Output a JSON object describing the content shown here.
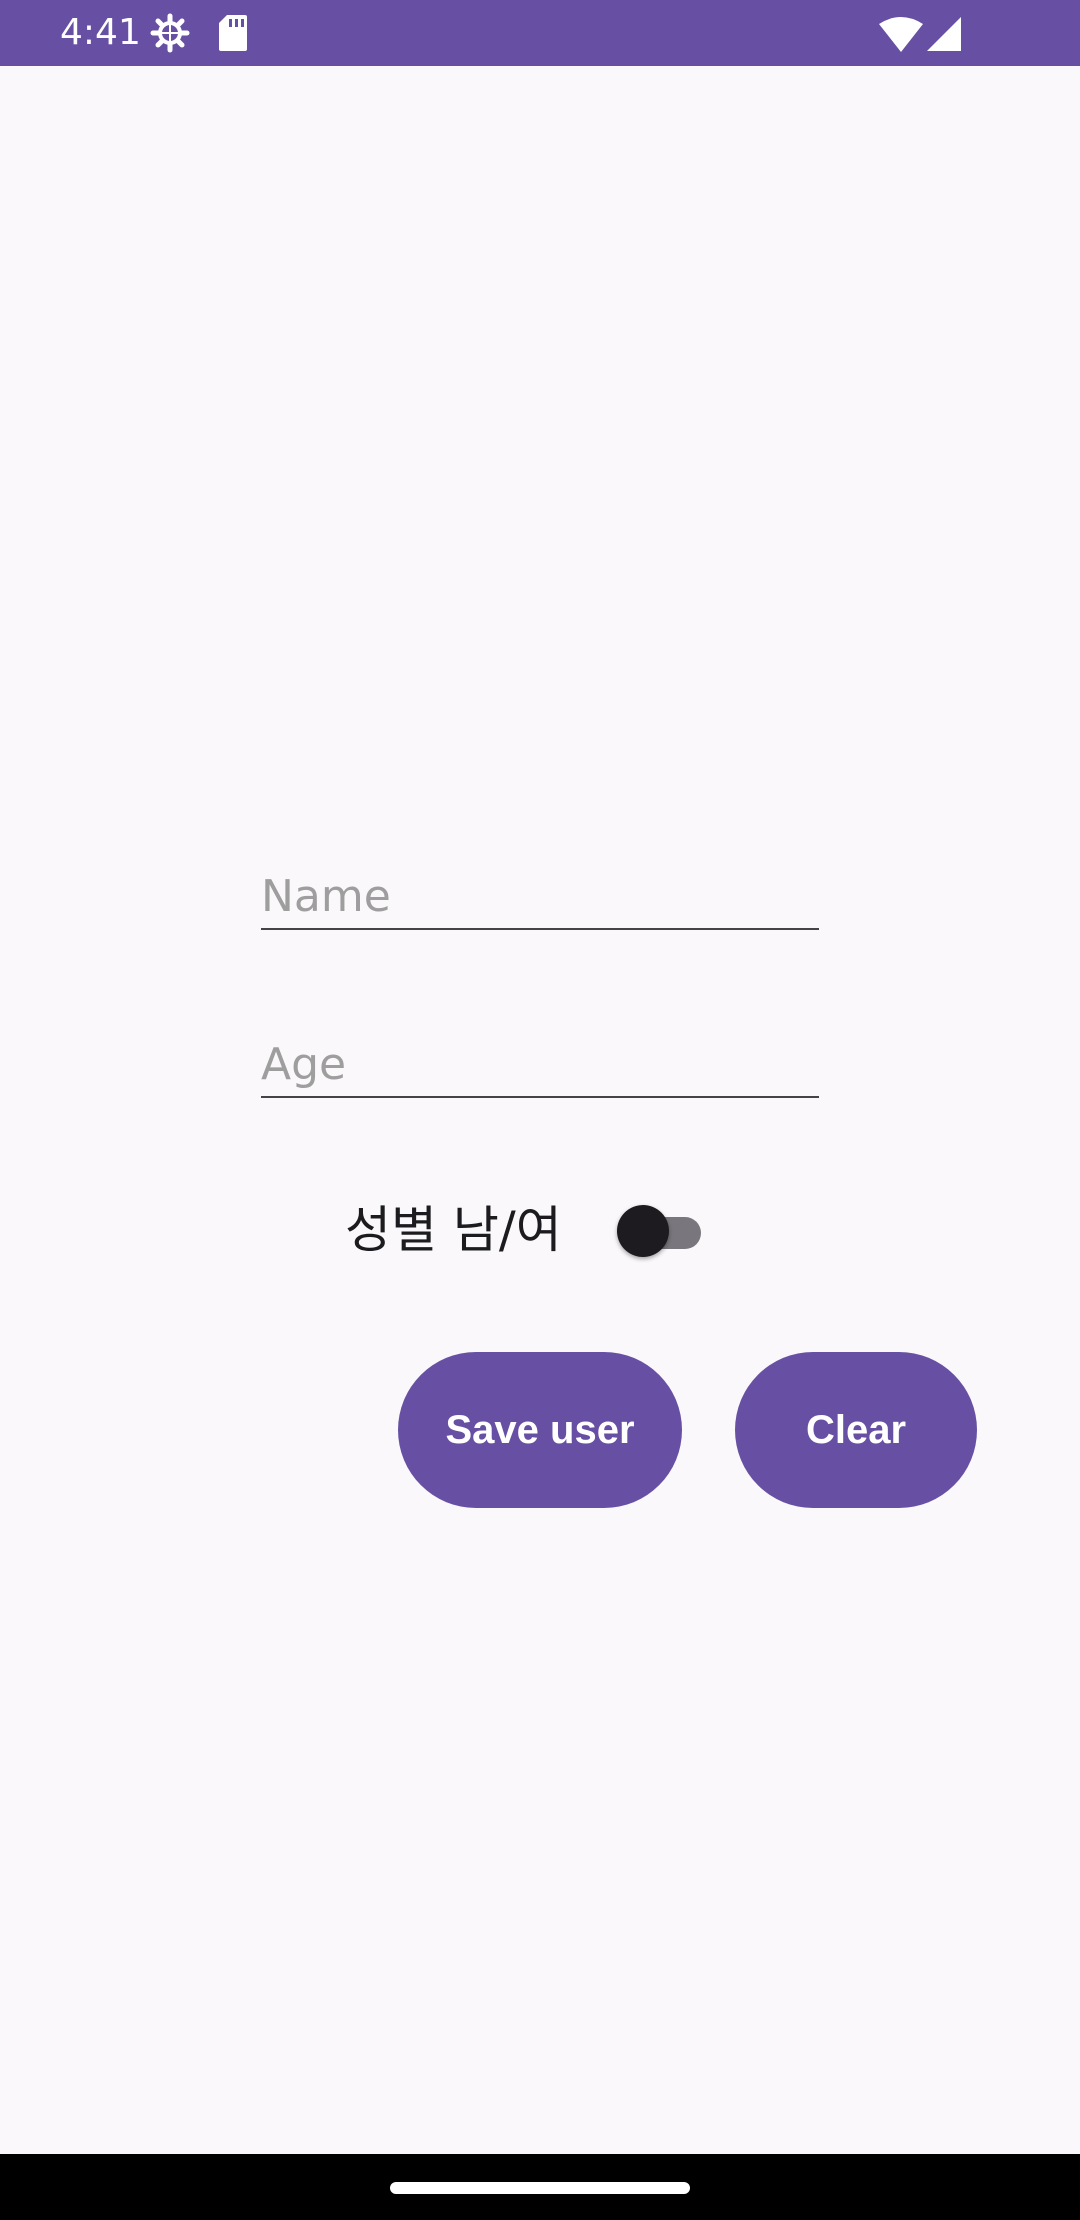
{
  "status_bar": {
    "time": "4:41",
    "background": "#6750a4",
    "icons": [
      "gear-icon",
      "sd-card-icon",
      "wifi-icon",
      "signal-icon"
    ]
  },
  "form": {
    "name_placeholder": "Name",
    "name_value": "",
    "age_placeholder": "Age",
    "age_value": "",
    "gender_label": "성별 남/여",
    "gender_switch_on": false
  },
  "buttons": {
    "save_label": "Save user",
    "clear_label": "Clear",
    "color": "#6750a4"
  }
}
